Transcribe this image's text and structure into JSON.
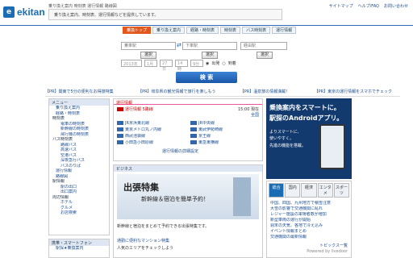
{
  "brand": {
    "mark": "e",
    "name": "ekitan"
  },
  "header": {
    "desc": "乗り換え案内 時刻表 運行情報 路線図",
    "tagline": "乗り換え案内、時刻表、運行情報などを提供しています。",
    "links": [
      "サイトマップ",
      "ヘルプ/FAQ",
      "お問い合わせ"
    ]
  },
  "tabs": [
    {
      "label": "乗換トップ",
      "active": true
    },
    {
      "label": "乗り換え案内",
      "active": false
    },
    {
      "label": "経路・時刻表",
      "active": false
    },
    {
      "label": "時刻表",
      "active": false
    },
    {
      "label": "バス時刻表",
      "active": false
    },
    {
      "label": "運行情報",
      "active": false
    }
  ],
  "search": {
    "from_placeholder": "乗車駅",
    "to_placeholder": "下車駅",
    "via_placeholder": "経由駅",
    "select_label": "選択",
    "year": "2013年",
    "month": "1月",
    "day": "27日",
    "hour": "14時",
    "minute": "9分",
    "depart_label": "出発",
    "arrive_label": "到着",
    "submit_label": "検 索"
  },
  "promo_links": [
    "【PR】関東で5分の便利なお得旅特集",
    "【PR】岐阜県の観光情報で旅行を楽しもう",
    "【PR】温泉旅の情報満載！",
    "【PR】東京の運行情報をスマホでチェック"
  ],
  "left_nav": {
    "title": "メニュー",
    "items": [
      {
        "label": "乗り換え案内",
        "kind": "item"
      },
      {
        "label": "経路・時刻表",
        "kind": "item"
      },
      {
        "label": "時刻表",
        "kind": "head"
      },
      {
        "label": "電車の時刻表",
        "kind": "sub"
      },
      {
        "label": "新幹線の時刻表",
        "kind": "sub"
      },
      {
        "label": "飛行機の時刻表",
        "kind": "sub"
      },
      {
        "label": "バス時刻表",
        "kind": "head"
      },
      {
        "label": "路線バス",
        "kind": "sub"
      },
      {
        "label": "高速バス",
        "kind": "sub"
      },
      {
        "label": "空港バス",
        "kind": "sub"
      },
      {
        "label": "深夜急行バス",
        "kind": "sub"
      },
      {
        "label": "バスのりば",
        "kind": "sub"
      },
      {
        "label": "運行情報",
        "kind": "item"
      },
      {
        "label": "路線図",
        "kind": "item"
      },
      {
        "label": "駅情報",
        "kind": "head"
      },
      {
        "label": "駅の出口",
        "kind": "sub"
      },
      {
        "label": "出口案内",
        "kind": "sub"
      },
      {
        "label": "周辺情報",
        "kind": "head"
      },
      {
        "label": "ホテル",
        "kind": "sub"
      },
      {
        "label": "グルメ",
        "kind": "sub"
      },
      {
        "label": "お店検索",
        "kind": "sub"
      }
    ],
    "section2_title": "携帯・スマートフォン",
    "section2_item": "駅探★乗換案内"
  },
  "service": {
    "title": "運行情報",
    "badge": "運行情報",
    "count": "5路線",
    "time": "15:00 現在",
    "toggle": "全国",
    "lines": [
      "JR京浜東北線",
      "JR中央線",
      "東京メトロ丸ノ内線",
      "東武伊勢崎線",
      "西武池袋線",
      "京王線",
      "小田急小田原線",
      "東急東横線"
    ],
    "more": "運行情報の詳細設定"
  },
  "business": {
    "title": "ビジネス",
    "hero_main": "出張特集",
    "hero_sub": "新幹線＆宿泊を簡単予約！",
    "body": "新幹線と宿泊をまとめて予約できる出張特集です。",
    "news_title": "通勤に便利なマンション特集",
    "news_body": "人気のエリアをチェックしよう"
  },
  "ad": {
    "line1": "乗換案内をスマートに。",
    "line2": "駅探のAndroidアプリ。",
    "line3": "よりスマートに、",
    "line4": "使いやすく。",
    "line5": "先進の機能を搭載。"
  },
  "news": {
    "tabs": [
      "総合",
      "国内",
      "経済",
      "エンタメ",
      "スポーツ"
    ],
    "items": [
      "中国、四国、九州地方で積雪注意",
      "大雪の影響で交通機関に乱れ",
      "レジャー施設の来場者数が増加",
      "新型車両の運行が開始",
      "週末の天気、各地で冷え込み",
      "イベント情報まとめ",
      "交通機関の最新情報"
    ],
    "more": "トピックス一覧",
    "powered": "Powered by livedoor"
  },
  "colors": {
    "brand": "#1a6db5",
    "accent": "#e2571c",
    "alert": "#cc0000"
  }
}
